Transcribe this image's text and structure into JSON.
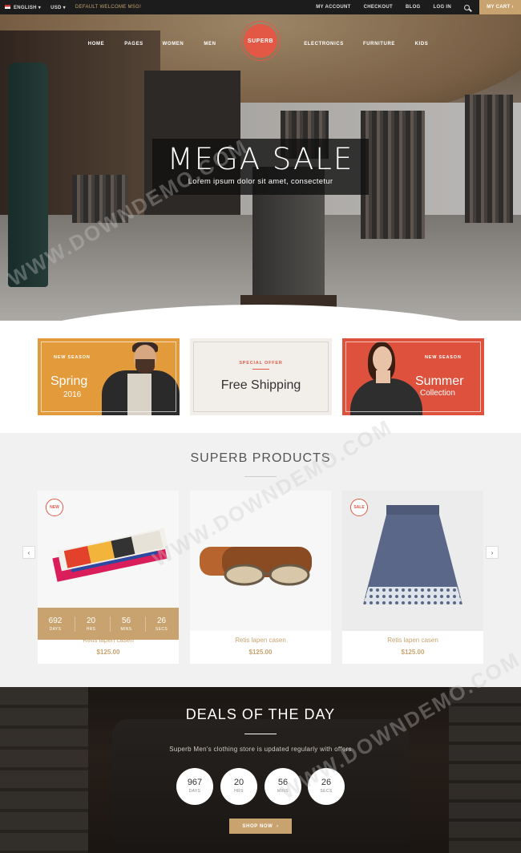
{
  "topbar": {
    "language": "ENGLISH",
    "currency": "USD",
    "welcome": "DEFAULT WELCOME MSG!",
    "links": [
      "MY ACCOUNT",
      "CHECKOUT",
      "BLOG",
      "LOG IN"
    ],
    "cart": "MY CART"
  },
  "nav": {
    "left": [
      "HOME",
      "PAGES",
      "WOMEN",
      "MEN"
    ],
    "logo": "SUPERB",
    "right": [
      "ELECTRONICS",
      "FURNITURE",
      "KIDS"
    ]
  },
  "hero": {
    "headline": "MEGA SALE",
    "subline": "Lorem ipsum dolor sit amet, consectetur"
  },
  "promos": [
    {
      "tag": "NEW SEASON",
      "title": "Spring",
      "sub": "2016"
    },
    {
      "tag": "SPECIAL OFFER",
      "title": "Free Shipping",
      "sub": ""
    },
    {
      "tag": "NEW SEASON",
      "title": "Summer",
      "sub": "Collection"
    }
  ],
  "products": {
    "title": "SUPERB PRODUCTS",
    "items": [
      {
        "badge": "NEW",
        "name": "Retis lapen casen",
        "price": "$125.00"
      },
      {
        "badge": "",
        "name": "Retis lapen casen",
        "price": "$125.00"
      },
      {
        "badge": "SALE",
        "name": "Retis lapen casen",
        "price": "$125.00"
      }
    ],
    "countdown": [
      {
        "value": "692",
        "label": "DAYS"
      },
      {
        "value": "20",
        "label": "HRS"
      },
      {
        "value": "56",
        "label": "MINS"
      },
      {
        "value": "26",
        "label": "SECS"
      }
    ]
  },
  "deals": {
    "title": "DEALS OF THE DAY",
    "desc": "Superb Men's clothing store is updated regularly with offers",
    "countdown": [
      {
        "value": "967",
        "label": "DAYS"
      },
      {
        "value": "20",
        "label": "HRS"
      },
      {
        "value": "56",
        "label": "MINS"
      },
      {
        "value": "26",
        "label": "SECS"
      }
    ],
    "cta": "SHOP NOW"
  },
  "colors": {
    "accent": "#c8a36f",
    "brand_red": "#e25845",
    "orange": "#e39a3a",
    "dark": "#1c1c1c"
  },
  "watermark": "WWW.DOWNDEMO.COM"
}
